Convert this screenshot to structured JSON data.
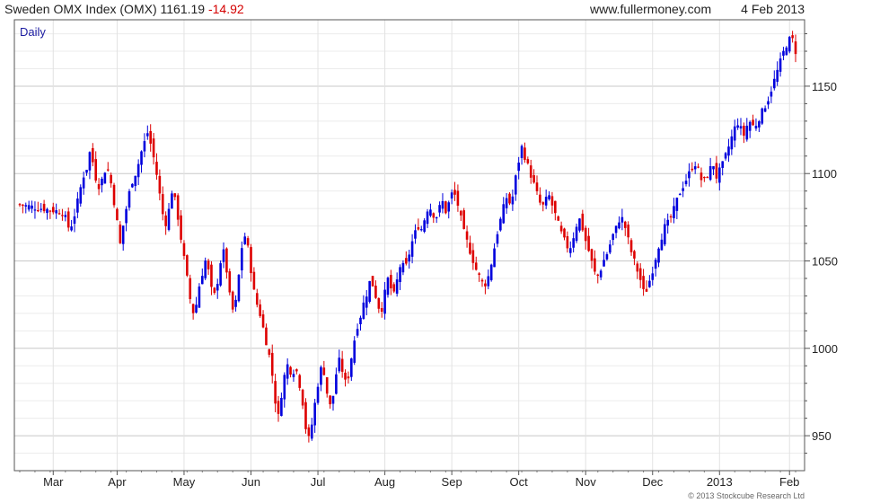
{
  "header": {
    "title": "Sweden OMX Index (OMX) 1161.19",
    "change": "-14.92",
    "site": "www.fullermoney.com",
    "date": "4 Feb 2013"
  },
  "footer": {
    "copyright": "© 2013 Stockcube Research Ltd"
  },
  "colors": {
    "up": "#0000dd",
    "down": "#dd0000",
    "grid": "#d8d8d8",
    "border": "#555555",
    "label": "#1a1aa0"
  },
  "chart_data": {
    "type": "candlestick",
    "label": "Daily",
    "ylim": [
      930,
      1188
    ],
    "y_ticks": [
      950,
      1000,
      1050,
      1100,
      1150
    ],
    "x_ticks": [
      "Mar",
      "Apr",
      "May",
      "Jun",
      "Jul",
      "Aug",
      "Sep",
      "Oct",
      "Nov",
      "Dec",
      "2013",
      "Feb"
    ],
    "x_tick_index": [
      11,
      32,
      54,
      76,
      98,
      120,
      142,
      164,
      186,
      208,
      230,
      253
    ],
    "grid": true,
    "close_sequence": [
      1078,
      1074,
      1068,
      1072,
      1080,
      1089,
      1098,
      1102,
      1112,
      1106,
      1095,
      1092,
      1100,
      1104,
      1097,
      1085,
      1072,
      1058,
      1074,
      1083,
      1094,
      1098,
      1104,
      1112,
      1118,
      1124,
      1115,
      1106,
      1094,
      1080,
      1070,
      1078,
      1090,
      1084,
      1072,
      1058,
      1046,
      1032,
      1020,
      1024,
      1036,
      1044,
      1052,
      1040,
      1028,
      1034,
      1048,
      1056,
      1044,
      1028,
      1020,
      1030,
      1052,
      1066,
      1060,
      1046,
      1032,
      1024,
      1018,
      1008,
      1000,
      990,
      972,
      960,
      974,
      986,
      992,
      984,
      990,
      982,
      972,
      955,
      948,
      958,
      972,
      984,
      992,
      978,
      966,
      972,
      986,
      994,
      985,
      978,
      990,
      1002,
      1012,
      1018,
      1026,
      1032,
      1040,
      1034,
      1026,
      1020,
      1030,
      1040,
      1034,
      1030,
      1042,
      1050,
      1044,
      1052,
      1060,
      1066,
      1070,
      1068,
      1076,
      1082,
      1078,
      1074,
      1080,
      1084,
      1078,
      1084,
      1090,
      1086,
      1078,
      1068,
      1062,
      1056,
      1050,
      1044,
      1040,
      1036,
      1038,
      1046,
      1056,
      1066,
      1074,
      1082,
      1088,
      1080,
      1094,
      1104,
      1116,
      1110,
      1104,
      1098,
      1092,
      1086,
      1080,
      1084,
      1088,
      1082,
      1076,
      1070,
      1064,
      1060,
      1056,
      1062,
      1070,
      1074,
      1068,
      1060,
      1054,
      1046,
      1040,
      1044,
      1050,
      1054,
      1060,
      1066,
      1070,
      1076,
      1072,
      1064,
      1056,
      1050,
      1044,
      1038,
      1030,
      1036,
      1042,
      1050,
      1058,
      1064,
      1070,
      1072,
      1076,
      1082,
      1088,
      1092,
      1096,
      1100,
      1104,
      1106,
      1100,
      1094,
      1098,
      1102,
      1106,
      1098,
      1102,
      1106,
      1112,
      1118,
      1124,
      1130,
      1126,
      1122,
      1128,
      1130,
      1126,
      1130,
      1134,
      1138,
      1142,
      1148,
      1154,
      1160,
      1166,
      1172,
      1176,
      1178,
      1171,
      1161
    ],
    "close_index_start": 14,
    "last_close": 1161.19
  }
}
